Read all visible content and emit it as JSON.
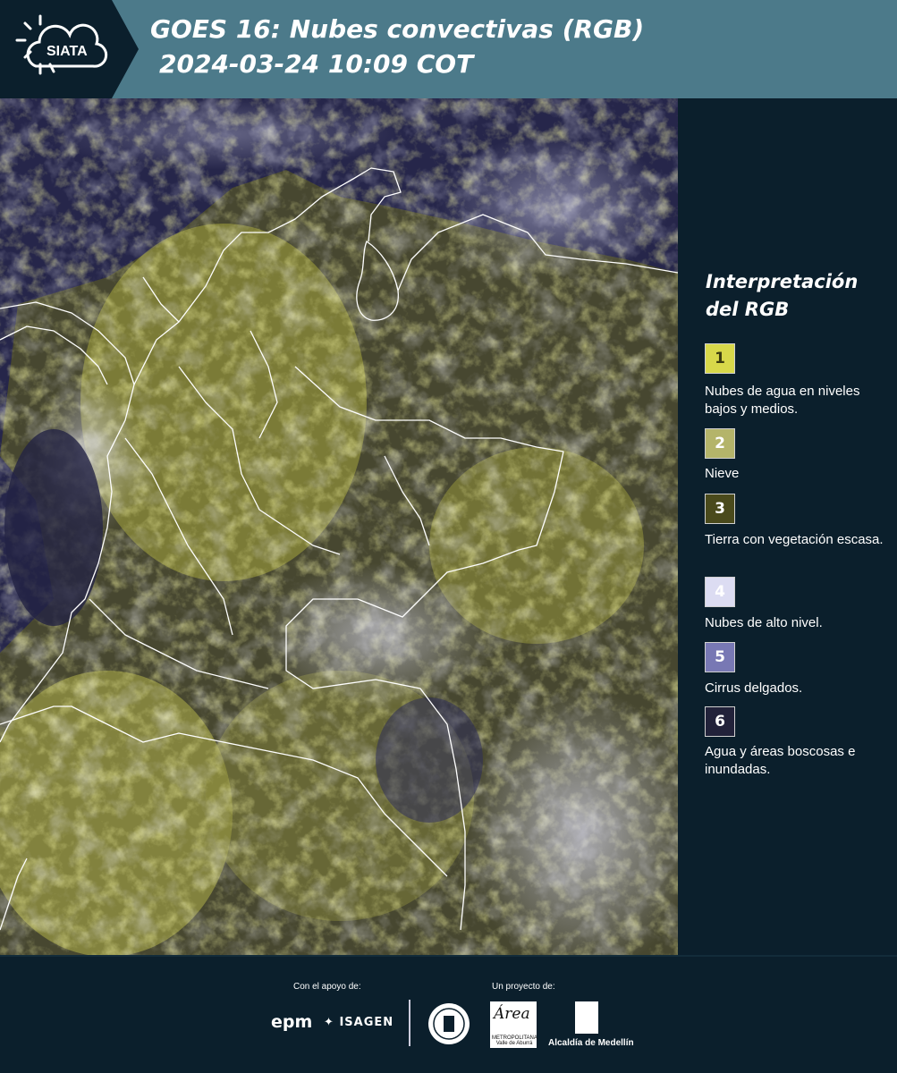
{
  "header": {
    "brand": "SIATA",
    "title_line1": "GOES 16: Nubes convectivas (RGB)",
    "title_line2": "2024-03-24 10:09 COT",
    "background_color": "#4c7a8a",
    "logo_color": "#0b1f2c"
  },
  "legend": {
    "title": "Interpretación del RGB",
    "items": [
      {
        "number": "1",
        "label": "Nubes de agua en niveles bajos y medios.",
        "color": "#d8d84a",
        "text_color": "#3a3a10"
      },
      {
        "number": "2",
        "label": "Nieve",
        "color": "#b4b46a",
        "text_color": "#ffffff"
      },
      {
        "number": "3",
        "label": "Tierra con vegetación escasa.",
        "color": "#4a4a1c",
        "text_color": "#ffffff"
      },
      {
        "number": "4",
        "label": "Nubes de alto nivel.",
        "color": "#dcdcf2",
        "text_color": "#ffffff"
      },
      {
        "number": "5",
        "label": "Cirrus delgados.",
        "color": "#7878b4",
        "text_color": "#ffffff"
      },
      {
        "number": "6",
        "label": "Agua y áreas boscosas e inundadas.",
        "color": "#22223a",
        "text_color": "#ffffff"
      }
    ]
  },
  "footer": {
    "support_label": "Con el apoyo de:",
    "project_label": "Un proyecto de:",
    "sponsors": [
      "epm",
      "ISAGEN"
    ],
    "partners": [
      "Área Metropolitana Valle de Aburrá",
      "Alcaldía de Medellín"
    ],
    "area_logo_text": "Área",
    "area_logo_sub": "METROPOLITANA Valle de Aburrá",
    "alcaldia_label": "Alcaldía de Medellín"
  }
}
